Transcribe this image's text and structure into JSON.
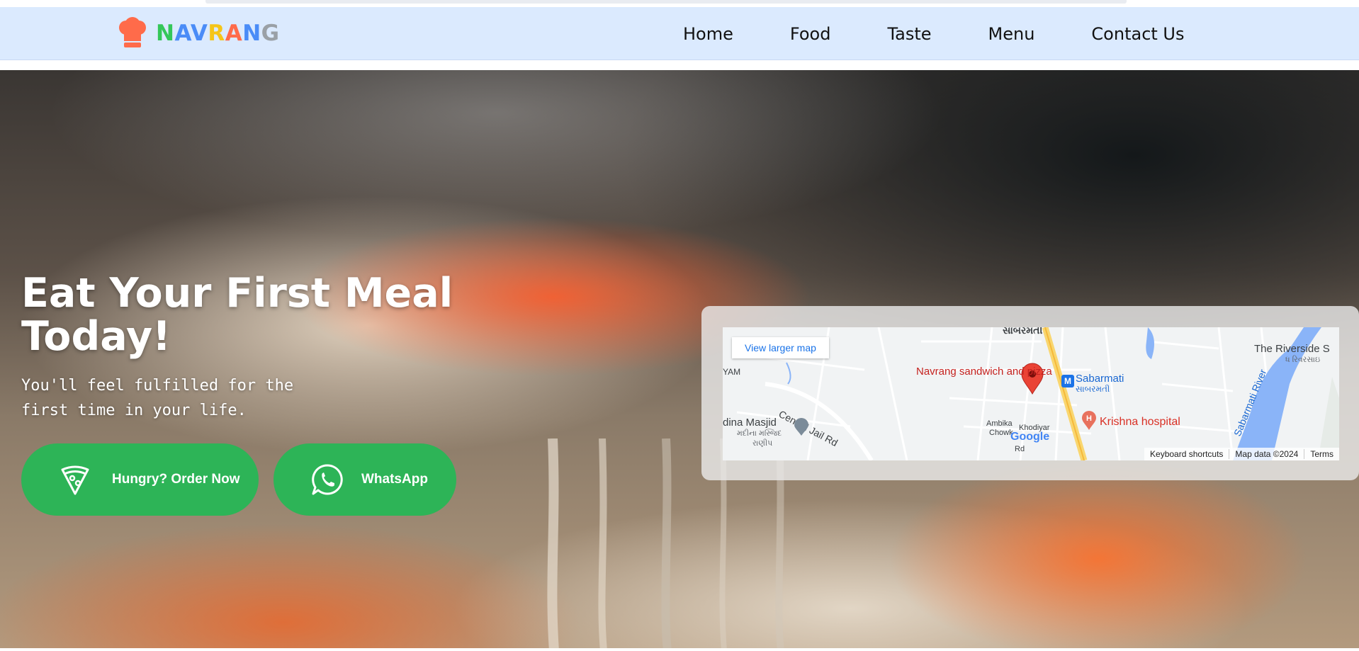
{
  "brand": {
    "name": "NAVRANG",
    "letter_colors": [
      "#34c759",
      "#4a8cf7",
      "#4a8cf7",
      "#f5c518",
      "#ff6b4a",
      "#4a8cf7",
      "#9aa0a6"
    ]
  },
  "nav": {
    "items": [
      "Home",
      "Food",
      "Taste",
      "Menu",
      "Contact Us"
    ]
  },
  "hero": {
    "title": "Eat Your First Meal Today!",
    "subtitle": "You'll feel fulfilled for the first time in your life.",
    "order_button": "Hungry? Order Now",
    "whatsapp_button": "WhatsApp",
    "button_color": "#2db457"
  },
  "map": {
    "view_larger": "View larger map",
    "place_name": "Navrang sandwich and pizza",
    "labels": {
      "sabarmati": "Sabarmati",
      "sabarmati_gu": "સાબરમતી",
      "krishna": "Krishna hospital",
      "central_jail": "Central Jail Rd",
      "madina": "dina Masjid",
      "madina_gu": "મદીના મસ્જિદ",
      "madina_gu2": "રાણીપ",
      "ambika": "Ambika",
      "chowk": "Chowk",
      "khodiyar": "Khodiyar",
      "rd": "Rd",
      "riverside": "The Riverside S",
      "riverside_gu": "ધ રિવરસાઇ",
      "river": "Sabarmati River",
      "yam": "YAM",
      "top_gu": "સાબરમતી",
      "google": "Google"
    },
    "footer": {
      "shortcuts": "Keyboard shortcuts",
      "data": "Map data ©2024",
      "terms": "Terms"
    }
  }
}
